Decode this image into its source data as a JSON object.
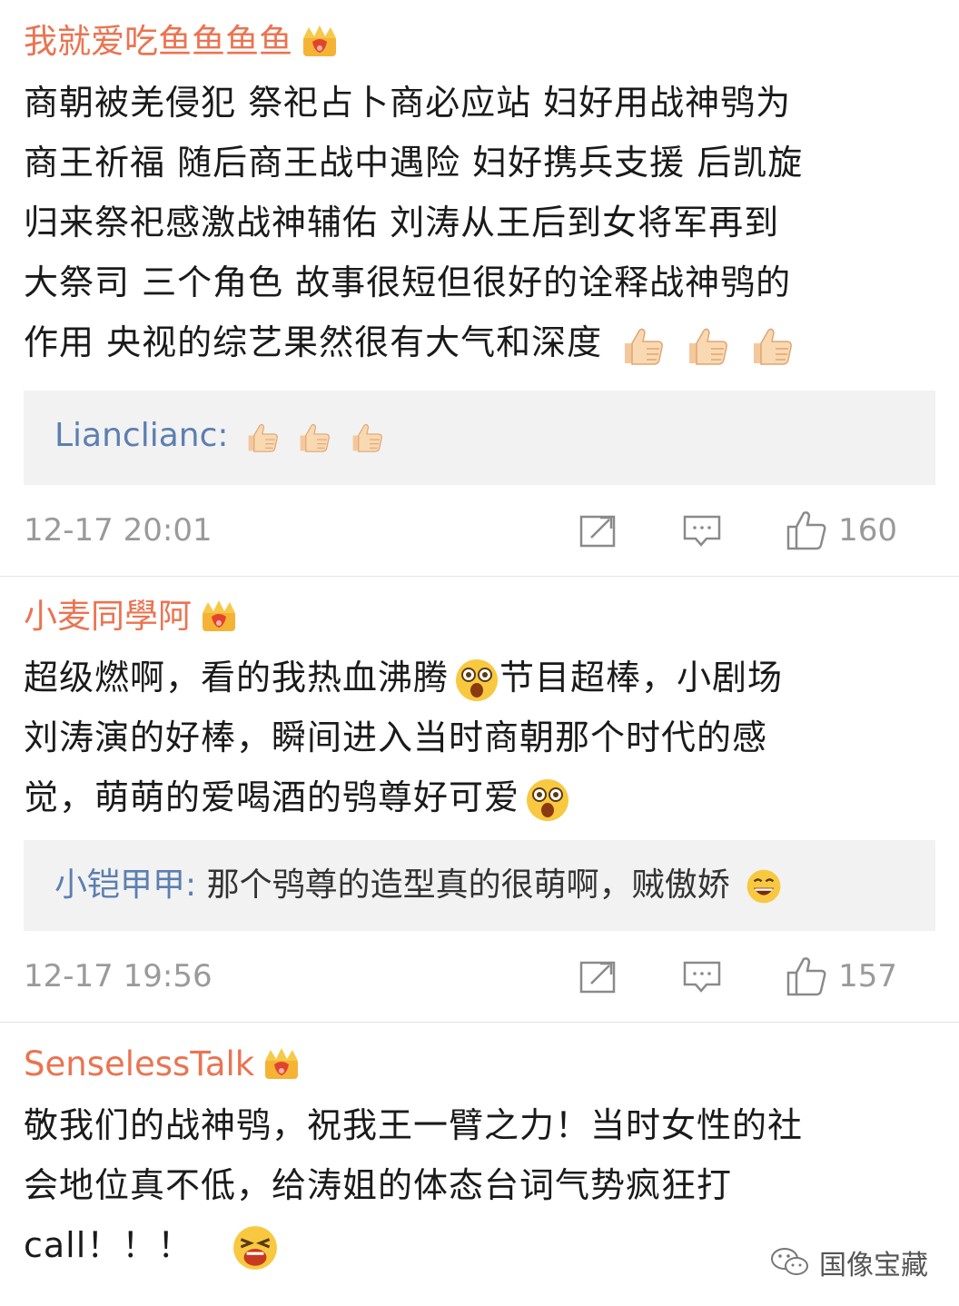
{
  "comments": [
    {
      "username": "我就爱吃鱼鱼鱼鱼",
      "lines": [
        "商朝被羌侵犯 祭祀占卜商必应站 妇好用战神鸮为",
        "商王祈福 随后商王战中遇险 妇好携兵支援 后凯旋",
        "归来祭祀感激战神辅佑 刘涛从王后到女将军再到",
        "大祭司 三个角色 故事很短但很好的诠释战神鸮的",
        "作用 央视的综艺果然很有大气和深度"
      ],
      "reply_user": "Lianclianc:",
      "reply_text": "",
      "timestamp": "12-17 20:01",
      "likes": "160"
    },
    {
      "username": "小麦同學阿",
      "lines": [
        "超级燃啊，看的我热血沸腾",
        "刘涛演的好棒，瞬间进入当时商朝那个时代的感",
        "觉，萌萌的爱喝酒的鸮尊好可爱"
      ],
      "line1_tail": "节目超棒，小剧场",
      "reply_user": "小铠甲甲:",
      "reply_text": "那个鸮尊的造型真的很萌啊，贼傲娇",
      "timestamp": "12-17 19:56",
      "likes": "157"
    },
    {
      "username": "SenselessTalk",
      "lines": [
        "敬我们的战神鸮，祝我王一臂之力！当时女性的社",
        "会地位真不低，给涛姐的体态台词气势疯狂打",
        "call！！！"
      ]
    }
  ],
  "watermark": "国像宝藏",
  "colors": {
    "username": "#eb7350",
    "reply_user": "#5b7fb0",
    "meta": "#9a9a9a",
    "reply_bg": "#f2f2f2"
  },
  "icons": [
    "crown-badge-icon",
    "thumbs-up-emoji-icon",
    "shocked-emoji-icon",
    "grin-emoji-icon",
    "crying-emoji-icon",
    "repost-icon",
    "comment-icon",
    "like-icon",
    "wechat-icon"
  ]
}
